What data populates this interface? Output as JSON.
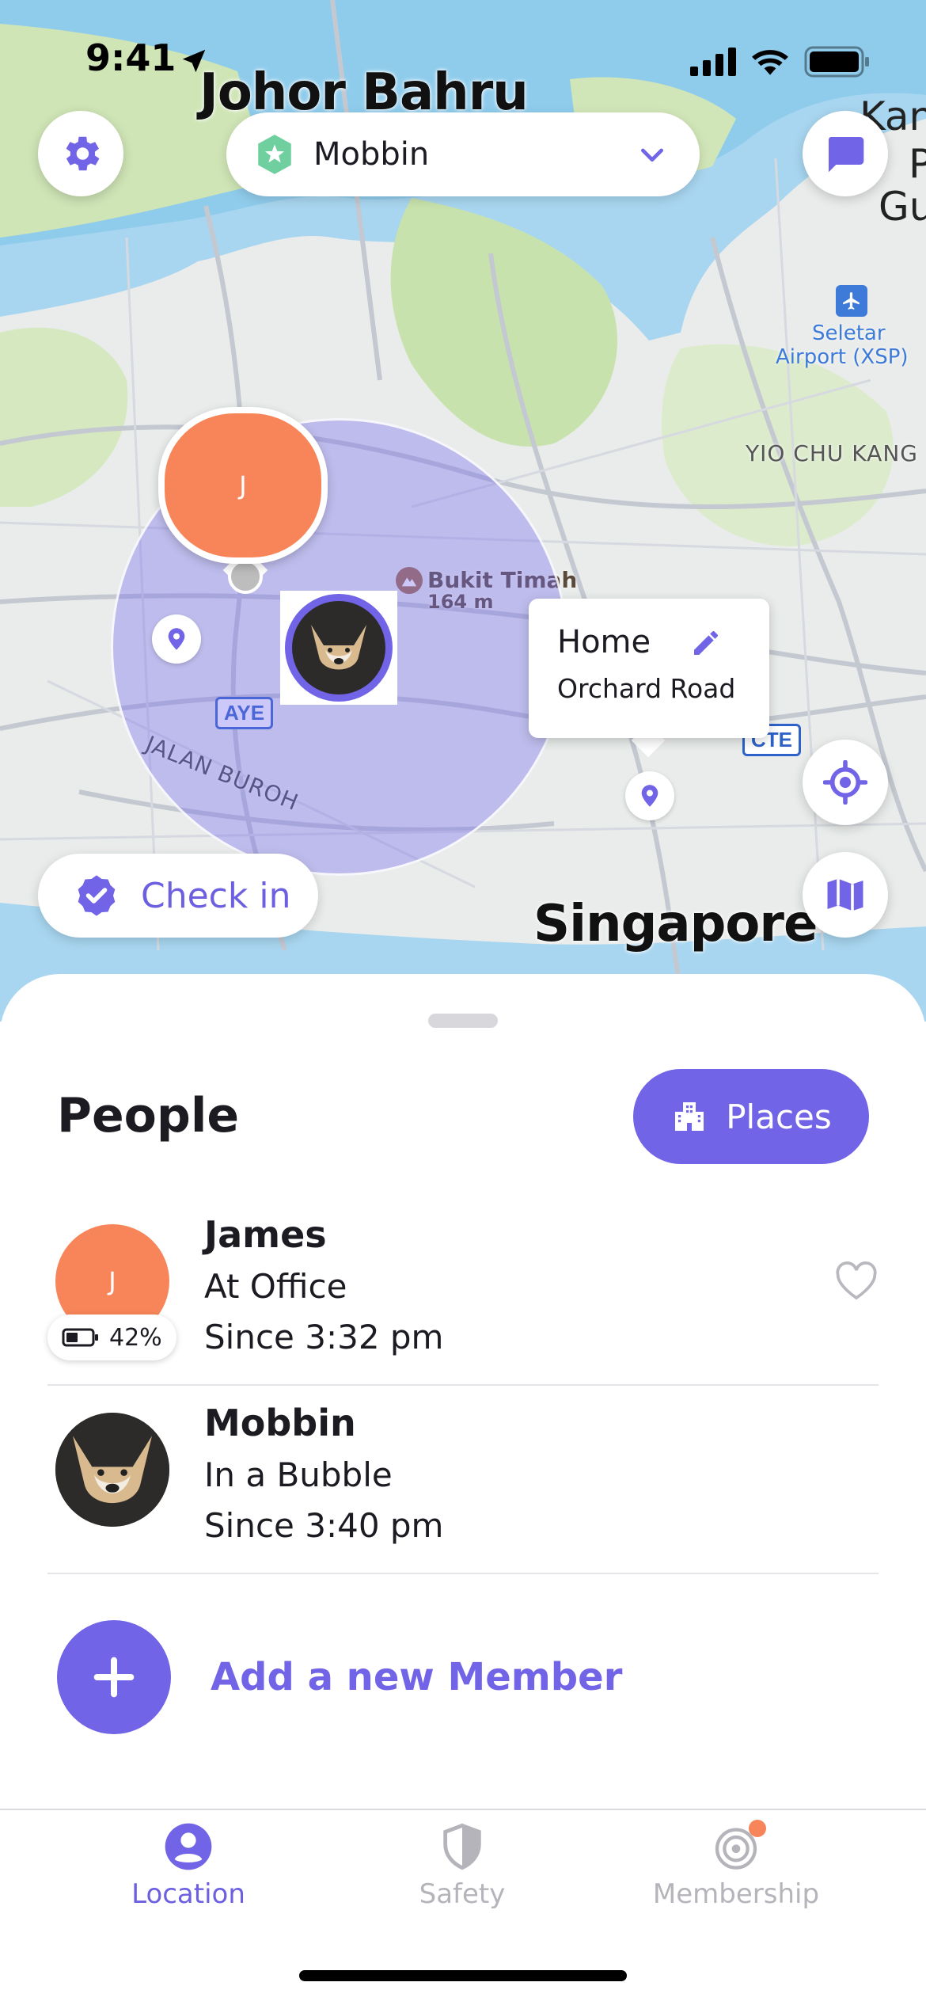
{
  "status_bar": {
    "time": "9:41"
  },
  "map": {
    "labels": {
      "johor_bahru": "Johor Bahru",
      "kan": "Kan",
      "p": "P",
      "gu": "Gu",
      "seletar": "Seletar",
      "airport": "Airport (XSP)",
      "yio_chu_kang": "YIO CHU KANG",
      "bukit_timah": "Bukit Timah",
      "bukit_timah_elev": "164 m",
      "aye": "AYE",
      "cte": "CTE",
      "jalan_buroh": "JALAN BUROH",
      "singapore": "Singapore"
    },
    "circle_selector": {
      "name": "Mobbin"
    },
    "member_marker_initial": "J",
    "home_card": {
      "title": "Home",
      "address": "Orchard Road"
    },
    "check_in_label": "Check in"
  },
  "sheet": {
    "title": "People",
    "places_label": "Places",
    "people": [
      {
        "name": "James",
        "initial": "J",
        "status": "At Office",
        "since": "Since 3:32 pm",
        "battery": "42%"
      },
      {
        "name": "Mobbin",
        "status": "In a Bubble",
        "since": "Since 3:40 pm"
      }
    ],
    "add_member_label": "Add a new Member"
  },
  "tabs": [
    {
      "label": "Location",
      "active": true
    },
    {
      "label": "Safety",
      "active": false
    },
    {
      "label": "Membership",
      "active": false
    }
  ],
  "colors": {
    "accent": "#7164e6",
    "member_orange": "#f78559",
    "notification_dot": "#f78559"
  }
}
